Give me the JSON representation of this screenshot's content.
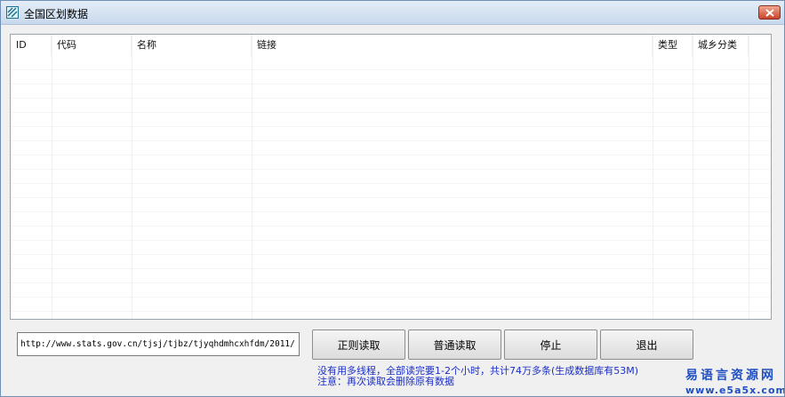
{
  "window": {
    "title": "全国区划数据"
  },
  "list": {
    "columns": [
      {
        "label": "ID"
      },
      {
        "label": "代码"
      },
      {
        "label": "名称"
      },
      {
        "label": "链接"
      },
      {
        "label": "类型"
      },
      {
        "label": "城乡分类"
      }
    ]
  },
  "url_input": {
    "value": "http://www.stats.gov.cn/tjsj/tjbz/tjyqhdmhcxhfdm/2011/"
  },
  "buttons": {
    "regex_read": "正则读取",
    "normal_read": "普通读取",
    "stop": "停止",
    "exit": "退出"
  },
  "info": {
    "line1": "没有用多线程，全部读完要1-2个小时，共计74万多条(生成数据库有53M)",
    "line2": "注意：再次读取会删除原有数据"
  },
  "watermark": {
    "name": "易语言资源网",
    "url": "www.e5a5x.com"
  },
  "colors": {
    "info_text": "#1a2ec8",
    "watermark": "#1f4fc2",
    "close_button": "#c9432c"
  }
}
